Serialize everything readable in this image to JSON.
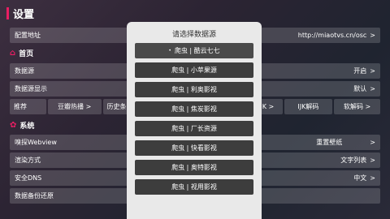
{
  "header": {
    "title": "设置"
  },
  "rows_top": [
    {
      "label": "配置地址",
      "value": "http://miaotvs.cn/osc",
      "chev": ">"
    }
  ],
  "section_home": {
    "title": "首页"
  },
  "rows_home": [
    {
      "label": "数据源",
      "value": "开启",
      "chev": ">"
    },
    {
      "label": "数据源显示",
      "value": "默认",
      "chev": ">"
    }
  ],
  "recommend_row": {
    "label": "推荐",
    "cells": [
      "豆瓣热播 >",
      "历史条",
      "IJK >",
      "IJK解码",
      "软解码 >"
    ]
  },
  "section_system": {
    "title": "系统"
  },
  "rows_system": [
    {
      "label": "嗅探Webview",
      "mid": "重置壁纸",
      "value": "",
      "chev": ">"
    },
    {
      "label": "渲染方式",
      "value": "文字列表",
      "chev": ">"
    },
    {
      "label": "安全DNS",
      "value": "中文",
      "chev": ">"
    },
    {
      "label": "数据备份还原",
      "value": "",
      "chev": ""
    }
  ],
  "dialog": {
    "title": "请选择数据源",
    "selected_marker": "•",
    "items": [
      "爬虫 | 酷云七七",
      "爬虫 | 小苹果源",
      "爬虫 | 利奥影视",
      "爬虫 | 焦炭影视",
      "爬虫 | 厂长资源",
      "爬虫 | 快看影视",
      "爬虫 | 奥特影视",
      "爬虫 | 视用影视"
    ]
  },
  "colors": {
    "accent": "#e91e63"
  },
  "icons": {
    "home": "home-icon",
    "system": "gear-icon"
  }
}
